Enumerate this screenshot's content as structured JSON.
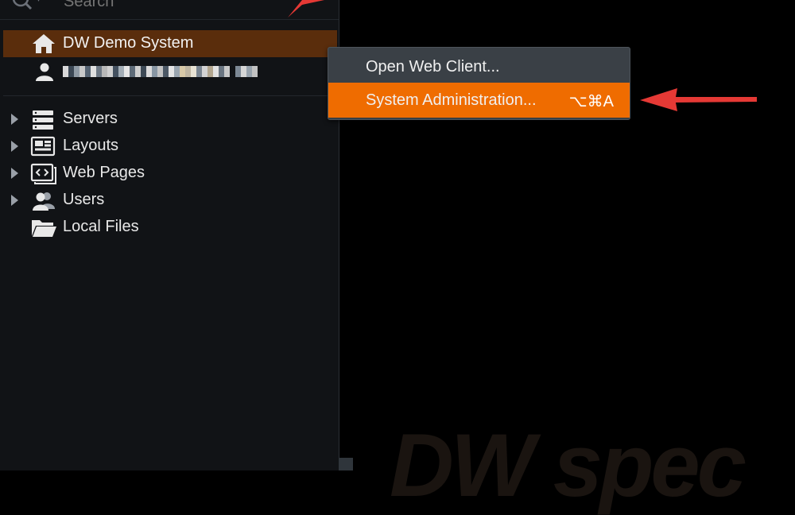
{
  "search": {
    "placeholder": "Search"
  },
  "tree": {
    "server": {
      "label": "DW Demo System",
      "icon": "home-icon"
    },
    "user": {
      "icon": "user-icon"
    },
    "items": [
      {
        "label": "Servers",
        "icon": "servers-icon",
        "expandable": true
      },
      {
        "label": "Layouts",
        "icon": "layouts-icon",
        "expandable": true
      },
      {
        "label": "Web Pages",
        "icon": "web-pages-icon",
        "expandable": true
      },
      {
        "label": "Users",
        "icon": "users-icon",
        "expandable": true
      },
      {
        "label": "Local Files",
        "icon": "folder-icon",
        "expandable": false
      }
    ]
  },
  "context_menu": {
    "items": [
      {
        "label": "Open Web Client...",
        "shortcut": ""
      },
      {
        "label": "System Administration...",
        "shortcut": "⌥⌘A"
      }
    ]
  },
  "watermark": {
    "text": "DW spec"
  },
  "colors": {
    "selected_row": "#5a2d0c",
    "menu_highlight": "#ef6c00",
    "annotation_arrow": "#e53935",
    "panel_bg": "#111316",
    "menu_bg": "#3a4046"
  }
}
